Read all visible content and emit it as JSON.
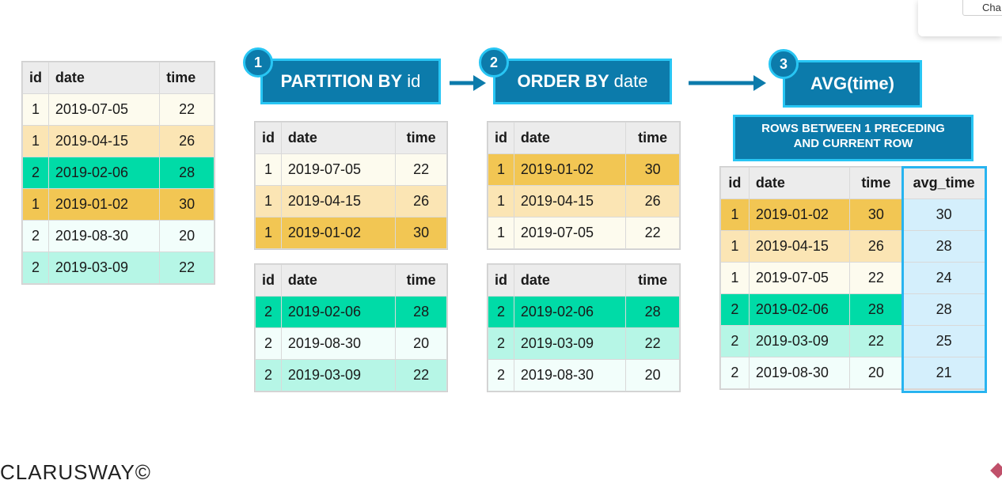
{
  "headers": {
    "id": "id",
    "date": "date",
    "time": "time",
    "avg_time": "avg_time"
  },
  "source_rows": [
    {
      "id": "1",
      "date": "2019-07-05",
      "time": "22"
    },
    {
      "id": "1",
      "date": "2019-04-15",
      "time": "26"
    },
    {
      "id": "2",
      "date": "2019-02-06",
      "time": "28"
    },
    {
      "id": "1",
      "date": "2019-01-02",
      "time": "30"
    },
    {
      "id": "2",
      "date": "2019-08-30",
      "time": "20"
    },
    {
      "id": "2",
      "date": "2019-03-09",
      "time": "22"
    }
  ],
  "steps": [
    {
      "number": "1",
      "keyword": "PARTITION BY",
      "argument": "id"
    },
    {
      "number": "2",
      "keyword": "ORDER BY",
      "argument": "date"
    },
    {
      "number": "3",
      "keyword": "AVG(time)",
      "argument": ""
    }
  ],
  "frame_clause_line1": "ROWS BETWEEN 1 PRECEDING",
  "frame_clause_line2": "AND CURRENT ROW",
  "partition_1": [
    {
      "id": "1",
      "date": "2019-07-05",
      "time": "22"
    },
    {
      "id": "1",
      "date": "2019-04-15",
      "time": "26"
    },
    {
      "id": "1",
      "date": "2019-01-02",
      "time": "30"
    }
  ],
  "partition_2": [
    {
      "id": "2",
      "date": "2019-02-06",
      "time": "28"
    },
    {
      "id": "2",
      "date": "2019-08-30",
      "time": "20"
    },
    {
      "id": "2",
      "date": "2019-03-09",
      "time": "22"
    }
  ],
  "ordered_1": [
    {
      "id": "1",
      "date": "2019-01-02",
      "time": "30"
    },
    {
      "id": "1",
      "date": "2019-04-15",
      "time": "26"
    },
    {
      "id": "1",
      "date": "2019-07-05",
      "time": "22"
    }
  ],
  "ordered_2": [
    {
      "id": "2",
      "date": "2019-02-06",
      "time": "28"
    },
    {
      "id": "2",
      "date": "2019-03-09",
      "time": "22"
    },
    {
      "id": "2",
      "date": "2019-08-30",
      "time": "20"
    }
  ],
  "result_rows": [
    {
      "id": "1",
      "date": "2019-01-02",
      "time": "30",
      "avg_time": "30"
    },
    {
      "id": "1",
      "date": "2019-04-15",
      "time": "26",
      "avg_time": "28"
    },
    {
      "id": "1",
      "date": "2019-07-05",
      "time": "22",
      "avg_time": "24"
    },
    {
      "id": "2",
      "date": "2019-02-06",
      "time": "28",
      "avg_time": "28"
    },
    {
      "id": "2",
      "date": "2019-03-09",
      "time": "22",
      "avg_time": "25"
    },
    {
      "id": "2",
      "date": "2019-08-30",
      "time": "20",
      "avg_time": "21"
    }
  ],
  "logo_text": "CLARUSWAY©",
  "corner_button_label": "Cha",
  "colors": {
    "step_fill": "#0c7bab",
    "step_border": "#28c6f4",
    "row_07_05": "#fdfbee",
    "row_04_15": "#fbe5b4",
    "row_02_06": "#00dba7",
    "row_01_02": "#f2c653",
    "row_08_30": "#f2fefb",
    "row_03_09": "#b6f6e6",
    "avg_column": "#d4effc"
  }
}
